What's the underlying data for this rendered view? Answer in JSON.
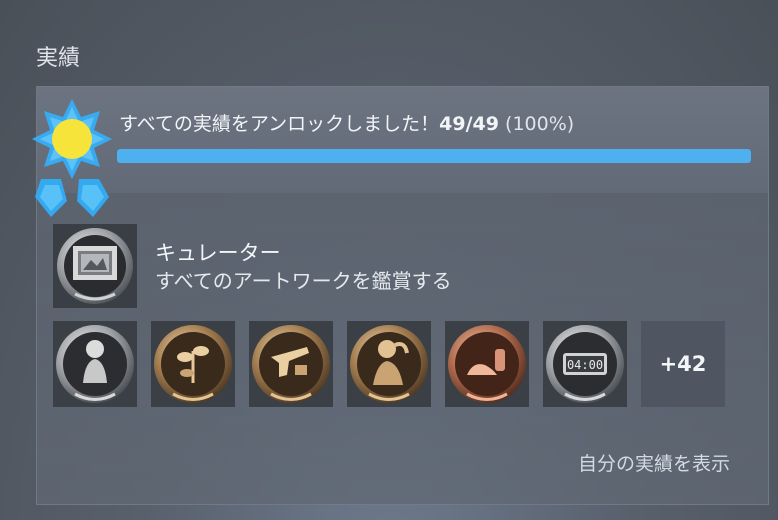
{
  "section_title": "実績",
  "summary": {
    "text": "すべての実績をアンロックしました！",
    "count": "49/49",
    "percent": "(100%)",
    "progress": 1.0
  },
  "featured": {
    "name": "キュレーター",
    "description": "すべてのアートワークを鑑賞する",
    "icon": "framed-painting-icon"
  },
  "achievements": [
    {
      "icon": "woman-portrait-medal-icon",
      "tint": "silver"
    },
    {
      "icon": "flower-medal-icon",
      "tint": "bronze"
    },
    {
      "icon": "revolver-medal-icon",
      "tint": "bronze"
    },
    {
      "icon": "woman-figure-medal-icon",
      "tint": "bronze"
    },
    {
      "icon": "shoes-medal-icon",
      "tint": "copper"
    },
    {
      "icon": "clock-medal-icon",
      "tint": "silver"
    }
  ],
  "clock_text": "04:00",
  "more_count": "+42",
  "view_link": "自分の実績を表示",
  "colors": {
    "accent": "#4fb0ef",
    "badge_blue": "#35a9f0",
    "badge_sun": "#f7e43a"
  }
}
